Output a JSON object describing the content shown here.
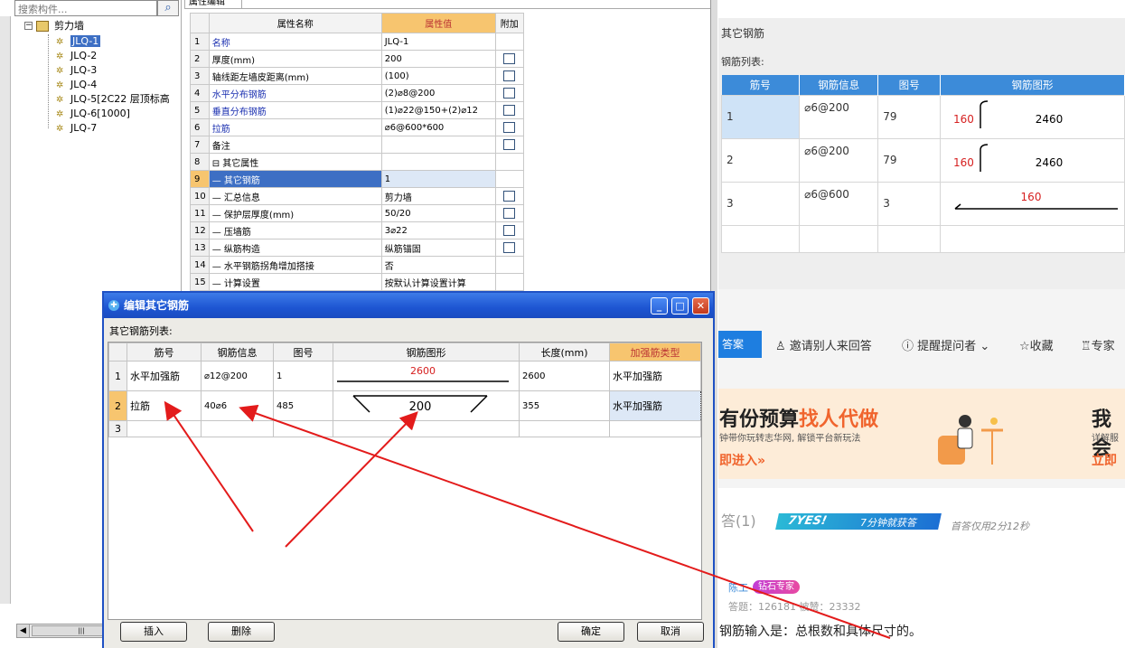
{
  "tree": {
    "search_placeholder": "搜索构件...",
    "root_label": "剪力墙",
    "items": [
      "JLQ-1",
      "JLQ-2",
      "JLQ-3",
      "JLQ-4",
      "JLQ-5[2C22 层顶标高",
      "JLQ-6[1000]",
      "JLQ-7"
    ],
    "selected_index": 0
  },
  "properties": {
    "tab_label": "属性编辑",
    "headers": {
      "name": "属性名称",
      "value": "属性值",
      "extra": "附加"
    },
    "rows": [
      {
        "num": "1",
        "name": "名称",
        "value": "JLQ-1",
        "blue": true,
        "checkbox": false
      },
      {
        "num": "2",
        "name": "厚度(mm)",
        "value": "200",
        "blue": false,
        "checkbox": true
      },
      {
        "num": "3",
        "name": "轴线距左墙皮距离(mm)",
        "value": "(100)",
        "blue": false,
        "checkbox": true
      },
      {
        "num": "4",
        "name": "水平分布钢筋",
        "value": "(2)⌀8@200",
        "blue": true,
        "checkbox": true
      },
      {
        "num": "5",
        "name": "垂直分布钢筋",
        "value": "(1)⌀22@150+(2)⌀12",
        "blue": true,
        "checkbox": true
      },
      {
        "num": "6",
        "name": "拉筋",
        "value": "⌀6@600*600",
        "blue": true,
        "checkbox": true
      },
      {
        "num": "7",
        "name": "备注",
        "value": "",
        "blue": false,
        "checkbox": true
      },
      {
        "num": "8",
        "name": "⊟ 其它属性",
        "value": "",
        "blue": false,
        "checkbox": false
      },
      {
        "num": "9",
        "name": "— 其它钢筋",
        "value": "1",
        "blue": false,
        "checkbox": false,
        "selected": true
      },
      {
        "num": "10",
        "name": "— 汇总信息",
        "value": "剪力墙",
        "blue": false,
        "checkbox": true
      },
      {
        "num": "11",
        "name": "— 保护层厚度(mm)",
        "value": "50/20",
        "blue": false,
        "checkbox": true
      },
      {
        "num": "12",
        "name": "— 压墙筋",
        "value": "3⌀22",
        "blue": false,
        "checkbox": true
      },
      {
        "num": "13",
        "name": "— 纵筋构造",
        "value": "纵筋锚固",
        "blue": false,
        "checkbox": true
      },
      {
        "num": "14",
        "name": "— 水平钢筋拐角增加搭接",
        "value": "否",
        "blue": false,
        "checkbox": false
      },
      {
        "num": "15",
        "name": "— 计算设置",
        "value": "按默认计算设置计算",
        "blue": false,
        "checkbox": false
      }
    ]
  },
  "dialog": {
    "title": "编辑其它钢筋",
    "list_label": "其它钢筋列表:",
    "headers": [
      "筋号",
      "钢筋信息",
      "图号",
      "钢筋图形",
      "长度(mm)",
      "加强筋类型"
    ],
    "rows": [
      {
        "num": "1",
        "name": "水平加强筋",
        "info": "⌀12@200",
        "fig": "1",
        "shape_label": "2600",
        "length": "2600",
        "type": "水平加强筋"
      },
      {
        "num": "2",
        "name": "拉筋",
        "info": "40⌀6",
        "fig": "485",
        "shape_label": "200",
        "length": "355",
        "type": "水平加强筋"
      },
      {
        "num": "3",
        "name": "",
        "info": "",
        "fig": "",
        "shape_label": "",
        "length": "",
        "type": ""
      }
    ],
    "buttons": {
      "insert": "插入",
      "delete": "删除",
      "ok": "确定",
      "cancel": "取消"
    }
  },
  "web": {
    "heading": "其它钢筋",
    "list_label": "钢筋列表:",
    "headers": [
      "筋号",
      "钢筋信息",
      "图号",
      "钢筋图形"
    ],
    "rows": [
      {
        "num": "1",
        "info": "⌀6@200",
        "fig": "79",
        "left": "160",
        "len": "2460"
      },
      {
        "num": "2",
        "info": "⌀6@200",
        "fig": "79",
        "left": "160",
        "len": "2460"
      },
      {
        "num": "3",
        "info": "⌀6@600",
        "fig": "3",
        "left": "160",
        "len": ""
      }
    ],
    "answer_btn": "答案",
    "actions": {
      "invite": "邀请别人来回答",
      "remind": "提醒提问者",
      "collect": "收藏",
      "expert": "专家"
    },
    "banner": {
      "title_a": "有份预算",
      "title_b": "找人代做",
      "sub": "钟带你玩转志华网, 解锁平台新玩法",
      "cta": "即进入»",
      "right_title": "我会",
      "right_sub": "详解服",
      "right_cta": "立即"
    },
    "answers_count": "答(1)",
    "yes_badge": "7YES!",
    "yes_sub": "7分钟就获答",
    "answer_time": "首答仅用2分12秒",
    "user": "陈工",
    "expert_badge": "钻石专家",
    "stats": "答题：126181  被赞：23332",
    "answer_text": "钢筋输入是：总根数和具体尺寸的。"
  }
}
